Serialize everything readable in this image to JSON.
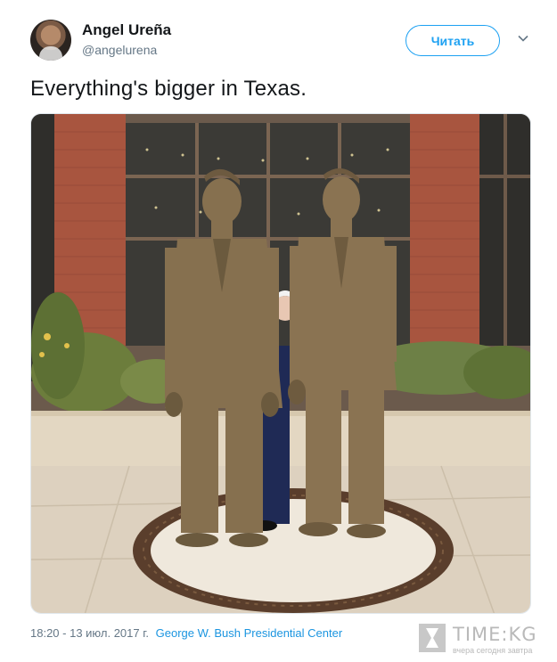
{
  "user": {
    "name": "Angel Ureña",
    "handle": "@angelurena"
  },
  "follow_button": {
    "label": "Читать"
  },
  "tweet": {
    "text": "Everything's bigger in Texas.",
    "timestamp": "18:20 - 13 июл. 2017 г.",
    "location": "George W. Bush Presidential Center"
  },
  "photo": {
    "icon": "photo-bronze-statues-with-man-peeking"
  },
  "watermark": {
    "brand": "TIME:KG",
    "tagline": "вчера сегодня завтра"
  },
  "colors": {
    "accent": "#1da1f2",
    "link": "#1b95e0",
    "muted": "#657786",
    "text": "#14171a"
  }
}
